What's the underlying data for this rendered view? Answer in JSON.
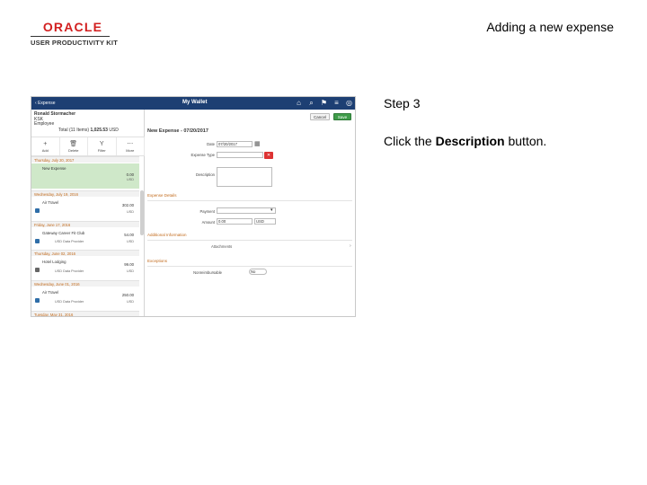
{
  "header": {
    "brand": "ORACLE",
    "product": "USER PRODUCTIVITY KIT",
    "slide_title": "Adding a new expense"
  },
  "step": {
    "label": "Step 3"
  },
  "instruction": {
    "before": "Click the ",
    "target": "Description",
    "after": " button."
  },
  "app": {
    "back_label": "Expense",
    "title": "My Wallet",
    "user_name": "Ronald Stormacher",
    "user_line2": "KSK",
    "user_line3": "Employee",
    "total_label": "Total (11 Items)",
    "total_value": "1,025.53",
    "total_currency": "USD",
    "tools": [
      {
        "icon": "+",
        "label": "Add"
      },
      {
        "icon": "🗑",
        "label": "Delete"
      },
      {
        "icon": "Y",
        "label": "Filter"
      },
      {
        "icon": "⋯",
        "label": "More"
      }
    ],
    "dates": [
      "Thursday, July 20, 2017",
      "Wednesday, July 19, 2016",
      "Friday, June 17, 2016",
      "Thursday, June 02, 2016",
      "Wednesday, June 01, 2016",
      "Tuesday, May 31, 2016"
    ],
    "rows": [
      {
        "name": "New Expense",
        "amount": "0.00",
        "currency": "USD",
        "sub": ""
      },
      {
        "name": "Air Travel",
        "amount": "302.00",
        "currency": "USD",
        "sub": ""
      },
      {
        "name": "Gateway Career Fit Club",
        "amount": "54.00",
        "currency": "USD",
        "sub": "USD Data Provider"
      },
      {
        "name": "Hotel Lodging",
        "amount": "99.00",
        "currency": "USD",
        "sub": "USD Data Provider"
      },
      {
        "name": "Air Travel",
        "amount": "250.00",
        "currency": "USD",
        "sub": "USD Data Provider"
      }
    ],
    "cancel_label": "Cancel",
    "save_label": "Save",
    "form_title": "New Expense - 07/20/2017",
    "fields": {
      "date_label": "Date",
      "date_value": "07/20/2017",
      "type_label": "Expense Type",
      "description_label": "Description",
      "payment_label": "Payment",
      "amount_label": "Amount",
      "amount_value": "0.00",
      "currency_value": "USD",
      "attach_label": "Attachments",
      "nonreimb_label": "Nonreimbursable",
      "nonreimb_value": "No"
    },
    "sections": {
      "expense_details": "Expense Details",
      "additional_info": "Additional Information",
      "exceptions": "Exceptions"
    }
  },
  "colors": {
    "topbar": "#1d3f73",
    "accent": "#c26a1b",
    "save": "#3f9c4a",
    "selected_row": "#cfe8c9",
    "logo_red": "#d21f1f"
  }
}
